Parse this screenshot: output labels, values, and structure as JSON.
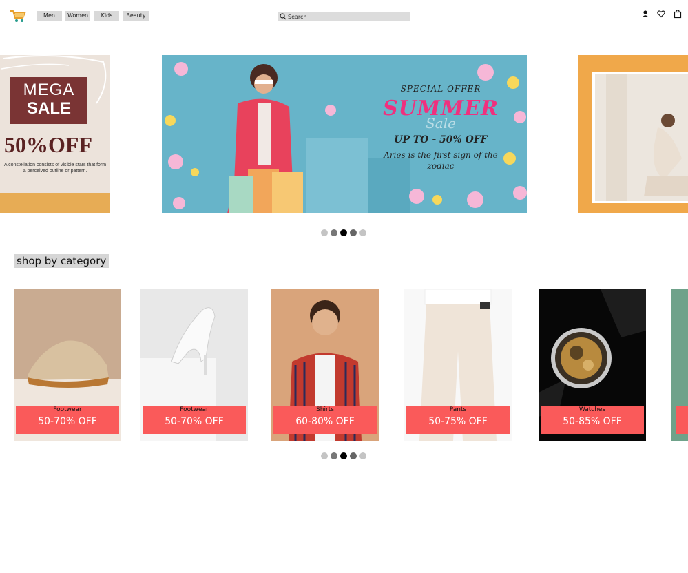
{
  "header": {
    "logo_icon": "shopping-cart-icon",
    "nav": [
      {
        "label": "Men"
      },
      {
        "label": "Women"
      },
      {
        "label": "Kids"
      },
      {
        "label": "Beauty"
      }
    ],
    "search": {
      "placeholder": "Search",
      "icon": "search-icon"
    },
    "icons": [
      "user-icon",
      "heart-icon",
      "shopping-bag-icon"
    ]
  },
  "banner": {
    "left": {
      "line1": "MEGA",
      "line2": "SALE",
      "discount": "50%OFF",
      "note": "A constellation consists of visible stars that form a perceived outline or pattern."
    },
    "center": {
      "special": "SPECIAL OFFER",
      "summer": "SUMMER",
      "sale": "Sale",
      "upto": "UP TO - 50% OFF",
      "tagline": "Aries is the first sign of the zodiac"
    },
    "active_index": 2,
    "dot_count": 5
  },
  "category": {
    "title": "shop by category",
    "items": [
      {
        "name": "Footwear",
        "discount": "50-70% OFF"
      },
      {
        "name": "Footwear",
        "discount": "50-70% OFF"
      },
      {
        "name": "Shirts",
        "discount": "60-80% OFF"
      },
      {
        "name": "Pants",
        "discount": "50-75% OFF"
      },
      {
        "name": "Watches",
        "discount": "50-85% OFF"
      }
    ],
    "active_index": 2,
    "dot_count": 5
  },
  "colors": {
    "label_bg": "#fa5a5a",
    "dots": [
      "#c4c4c4",
      "#777777",
      "#000000",
      "#666666",
      "#c4c4c4"
    ]
  }
}
